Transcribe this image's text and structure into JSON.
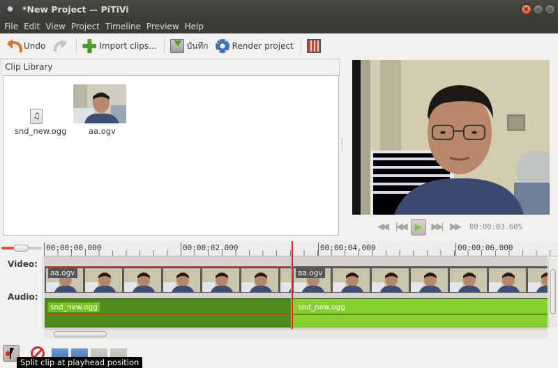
{
  "window": {
    "title": "*New Project — PiTiVi"
  },
  "menubar": {
    "items": [
      "File",
      "Edit",
      "View",
      "Project",
      "Timeline",
      "Preview",
      "Help"
    ]
  },
  "toolbar": {
    "undo_label": "Undo",
    "import_label": "Import clips...",
    "save_label": "บันทึก",
    "render_label": "Render project"
  },
  "clip_library": {
    "title": "Clip Library",
    "clips": [
      {
        "name": "snd_new.ogg",
        "type": "audio"
      },
      {
        "name": "aa.ogv",
        "type": "video"
      }
    ]
  },
  "viewer": {
    "timecode": "00:00:03.605"
  },
  "timeline": {
    "ruler_labels": [
      "00:00:00.000",
      "00:00:02.000",
      "00:00:04.000",
      "00:00:06.000"
    ],
    "tracks": {
      "video_label": "Video:",
      "audio_label": "Audio:"
    },
    "video_clips": [
      "aa.ogv",
      "aa.ogv"
    ],
    "audio_clips": [
      "snd_new.ogg",
      "snd_new.ogg"
    ]
  },
  "tooltip": {
    "text": "Split clip at playhead position"
  },
  "colors": {
    "accent": "#e0552c",
    "audio_clip": "#4f8a1c",
    "audio_clip_selected": "#86d12e",
    "playhead": "#dd2222"
  }
}
